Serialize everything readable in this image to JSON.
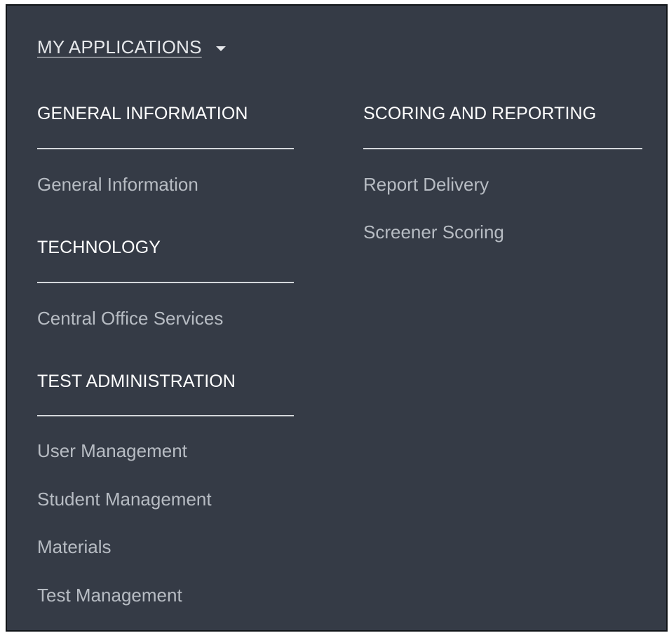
{
  "menu": {
    "title": "MY APPLICATIONS",
    "caret_icon": "caret-down-icon"
  },
  "left_column": {
    "general_information": {
      "heading": "GENERAL INFORMATION",
      "items": [
        "General Information"
      ]
    },
    "technology": {
      "heading": "TECHNOLOGY",
      "items": [
        "Central Office Services"
      ]
    },
    "test_administration": {
      "heading": "TEST ADMINISTRATION",
      "items": [
        "User Management",
        "Student Management",
        "Materials",
        "Test Management"
      ]
    }
  },
  "right_column": {
    "scoring_and_reporting": {
      "heading": "SCORING AND REPORTING",
      "items": [
        "Report Delivery",
        "Screener Scoring"
      ]
    }
  },
  "colors": {
    "background": "#353b46",
    "heading_text": "#ffffff",
    "link_text": "#b7bcc3",
    "divider": "#d4d7db"
  }
}
